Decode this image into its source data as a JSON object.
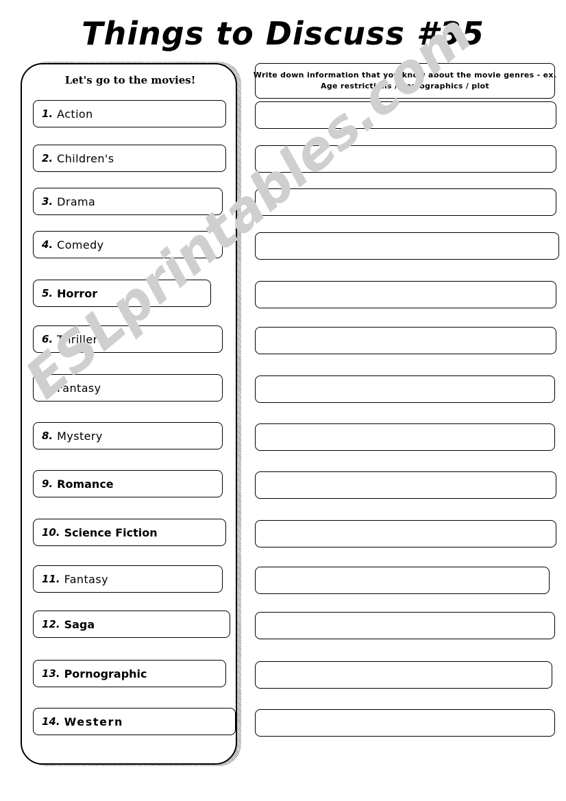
{
  "page": {
    "title": "Things to Discuss #35",
    "watermark": "ESLprintables.com",
    "watermark_color": "#cfcfcf",
    "background_color": "#ffffff",
    "ink_color": "#000000"
  },
  "left_panel": {
    "heading": "Let's go to the movies!",
    "items": [
      {
        "num": "1.",
        "label": "Action",
        "weight": "light"
      },
      {
        "num": "2.",
        "label": "Children's",
        "weight": "light"
      },
      {
        "num": "3.",
        "label": "Drama",
        "weight": "light"
      },
      {
        "num": "4.",
        "label": "Comedy",
        "weight": "light"
      },
      {
        "num": "5.",
        "label": "Horror",
        "weight": "bold"
      },
      {
        "num": "6.",
        "label": "Thriller",
        "weight": "light"
      },
      {
        "num": "7.",
        "label": "Fantasy",
        "weight": "light"
      },
      {
        "num": "8.",
        "label": "Mystery",
        "weight": "light"
      },
      {
        "num": "9.",
        "label": "Romance",
        "weight": "bold"
      },
      {
        "num": "10.",
        "label": "Science Fiction",
        "weight": "bold"
      },
      {
        "num": "11.",
        "label": "Fantasy",
        "weight": "light"
      },
      {
        "num": "12.",
        "label": "Saga",
        "weight": "bold"
      },
      {
        "num": "13.",
        "label": "Pornographic",
        "weight": "bold"
      },
      {
        "num": "14.",
        "label": "Western",
        "weight": "bold-wide"
      }
    ]
  },
  "right_panel": {
    "instruction_line_1": "Write down information that you know about the movie genres - ex.",
    "instruction_line_2": "Age restrictions / demographics / plot",
    "answer_rows": [
      {
        "value": ""
      },
      {
        "value": ""
      },
      {
        "value": ""
      },
      {
        "value": ""
      },
      {
        "value": ""
      },
      {
        "value": ""
      },
      {
        "value": ""
      },
      {
        "value": ""
      },
      {
        "value": ""
      },
      {
        "value": ""
      },
      {
        "value": ""
      },
      {
        "value": ""
      },
      {
        "value": ""
      },
      {
        "value": ""
      }
    ]
  }
}
